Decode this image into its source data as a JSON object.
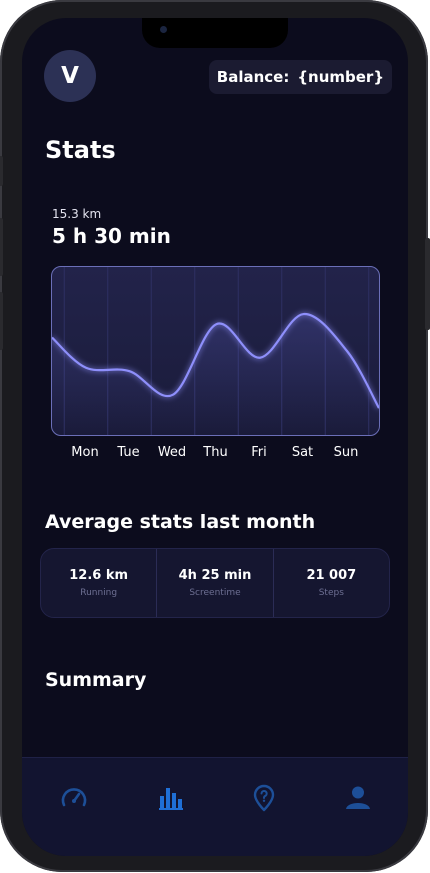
{
  "header": {
    "avatar_initial": "V",
    "balance_label": "Balance:",
    "balance_value": "{number}"
  },
  "stats": {
    "title": "Stats",
    "distance": "15.3 km",
    "duration": "5 h 30 min"
  },
  "chart_data": {
    "type": "line",
    "categories": [
      "Mon",
      "Tue",
      "Wed",
      "Thu",
      "Fri",
      "Sat",
      "Sun"
    ],
    "series": [
      {
        "values": [
          0.4,
          0.38,
          0.24,
          0.66,
          0.46,
          0.72,
          0.5
        ]
      }
    ],
    "ylim": [
      0,
      1
    ],
    "grid": true
  },
  "average": {
    "title": "Average stats last month",
    "items": [
      {
        "value": "12.6 km",
        "label": "Running"
      },
      {
        "value": "4h 25 min",
        "label": "Screentime"
      },
      {
        "value": "21 007",
        "label": "Steps"
      }
    ]
  },
  "summary": {
    "title": "Summary"
  },
  "tabbar": {
    "accent": "#1f6fd6",
    "inactive": "#1d4f98",
    "icons": [
      "speedometer-icon",
      "bar-chart-icon",
      "location-help-icon",
      "profile-icon"
    ],
    "active_index": 1
  }
}
